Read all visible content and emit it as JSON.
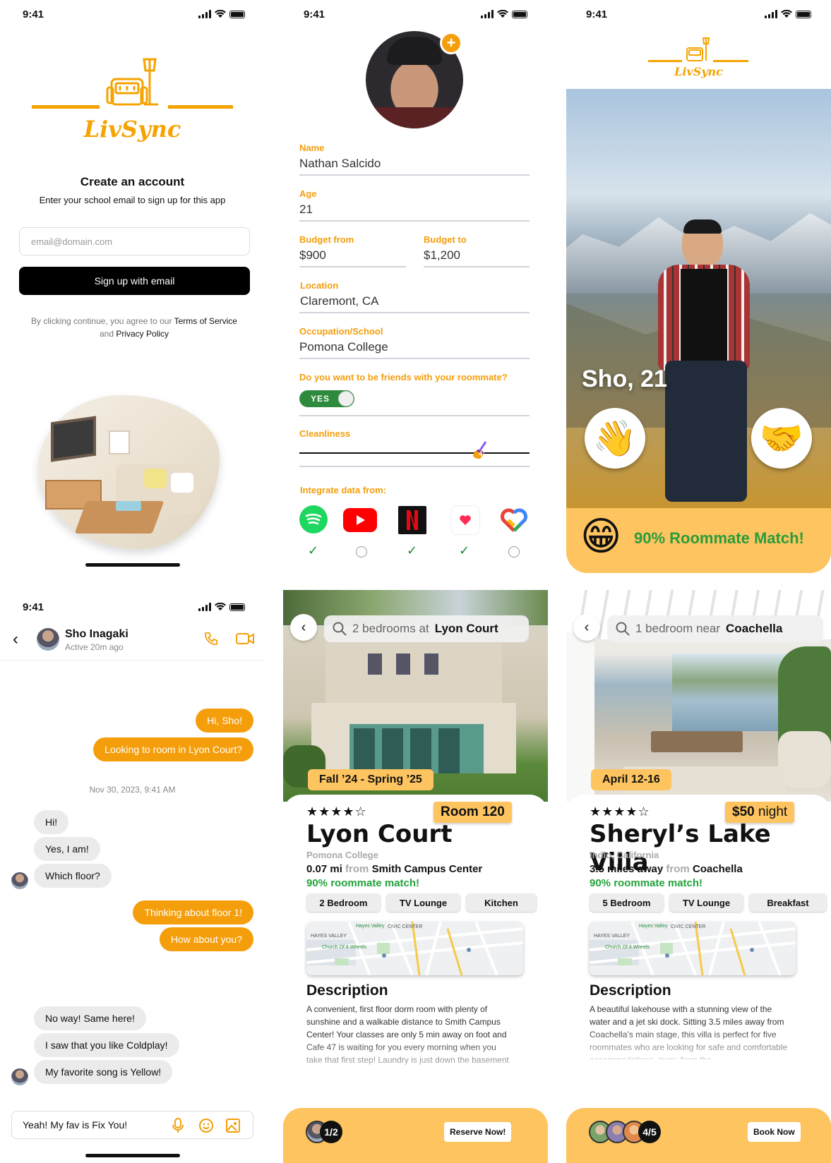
{
  "status": {
    "time": "9:41"
  },
  "signup": {
    "brand": "LivSync",
    "title": "Create an account",
    "subtitle": "Enter your school email to sign up for this app",
    "email_placeholder": "email@domain.com",
    "button": "Sign up with email",
    "terms_prefix": "By clicking continue, you agree to our",
    "terms_link": "Terms of Service",
    "terms_and": "and",
    "privacy_link": "Privacy Policy"
  },
  "profile": {
    "fields": {
      "name_label": "Name",
      "name_value": "Nathan Salcido",
      "age_label": "Age",
      "age_value": "21",
      "budget_from_label": "Budget from",
      "budget_from_value": "$900",
      "budget_to_label": "Budget to",
      "budget_to_value": "$1,200",
      "location_label": "Location",
      "location_value": "Claremont, CA",
      "occupation_label": "Occupation/School",
      "occupation_value": "Pomona College"
    },
    "friends_question": "Do you want to be friends with your roommate?",
    "toggle_label": "YES",
    "cleanliness_label": "Cleanliness",
    "cleanliness_value": "4",
    "integrate_label": "Integrate data from:",
    "integrations": [
      {
        "name": "spotify",
        "checked": true
      },
      {
        "name": "youtube",
        "checked": false
      },
      {
        "name": "netflix",
        "checked": true
      },
      {
        "name": "apple-health",
        "checked": true
      },
      {
        "name": "google-fit",
        "checked": false
      }
    ]
  },
  "match": {
    "brand": "LivSync",
    "person": "Sho, 21",
    "match_text": "90% Roommate Match!"
  },
  "chat": {
    "contact_name": "Sho Inagaki",
    "contact_status": "Active 20m ago",
    "timestamp": "Nov 30, 2023, 9:41 AM",
    "messages": [
      {
        "text": "Hi, Sho!"
      },
      {
        "text": "Looking to room in Lyon Court?"
      },
      {
        "text": "Hi!"
      },
      {
        "text": "Yes, I am!"
      },
      {
        "text": "Which floor?"
      },
      {
        "text": "Thinking about floor 1!"
      },
      {
        "text": "How about you?"
      },
      {
        "text": "No way! Same here!"
      },
      {
        "text": "I saw that you like Coldplay!"
      },
      {
        "text": "My favorite song is Yellow!"
      }
    ],
    "input_value": "Yeah! My fav is Fix You!"
  },
  "listing1": {
    "search_prefix": "2 bedrooms at",
    "search_bold": "Lyon Court",
    "date": "Fall ’24 - Spring ’25",
    "stars": "★★★★☆",
    "rating": 4,
    "tag": "Room 120",
    "title": "Lyon Court",
    "subtitle": "Pomona College",
    "dist_value": "0.07 mi",
    "dist_from": "from",
    "dist_place": "Smith Campus Center",
    "match": "90% roommate match!",
    "chips": [
      "2 Bedroom",
      "TV Lounge",
      "Kitchen"
    ],
    "desc_title": "Description",
    "desc": "A convenient, first floor dorm room with plenty of sunshine and a walkable distance to Smith Campus Center! Your classes are only 5 min away on foot and Cafe 47 is waiting for you every morning when you take that first step! Laundry is just down the basement",
    "count": "1/2",
    "button": "Reserve Now!"
  },
  "listing2": {
    "search_prefix": "1 bedroom near",
    "search_bold": "Coachella",
    "date": "April 12-16",
    "stars": "★★★★☆",
    "rating": 4,
    "tag_price": "$50",
    "tag_unit": "night",
    "title": "Sheryl’s Lake Villa",
    "subtitle": "Indio, California",
    "dist_value": "3.5 miles away",
    "dist_from": "from",
    "dist_place": "Coachella",
    "match": "90% roommate match!",
    "chips": [
      "5 Bedroom",
      "TV Lounge",
      "Breakfast"
    ],
    "desc_title": "Description",
    "desc": "A beautiful lakehouse with a stunning view of the water and a jet ski dock. Sitting 3.5 miles away from Coachella’s main stage, this villa is perfect for five roommates who are looking for safe and comfortable accommodations, away from the",
    "count": "4/5",
    "button": "Book Now"
  },
  "map_labels": {
    "hayes": "HAYES VALLEY",
    "civic": "CIVIC CENTER",
    "valley": "Hayes Valley",
    "church": "Church Of 8 Wheels"
  },
  "colors": {
    "accent": "#f59e0b",
    "accent_light": "#fdc460",
    "match_green": "#22a33a"
  }
}
